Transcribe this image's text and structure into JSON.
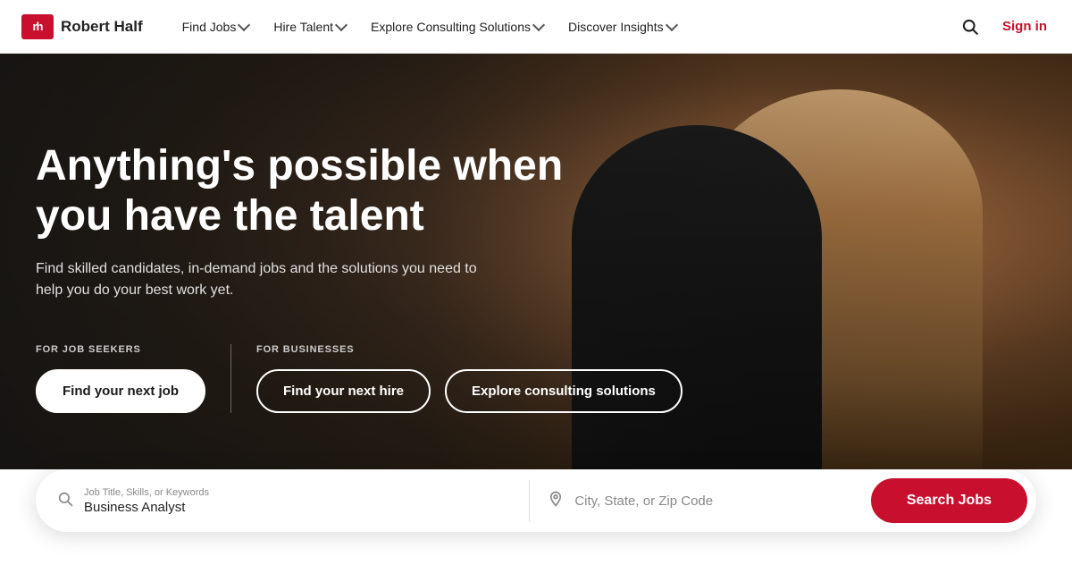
{
  "brand": {
    "logo_text": "rh",
    "name": "Robert Half"
  },
  "nav": {
    "items": [
      {
        "id": "find-jobs",
        "label": "Find Jobs",
        "has_dropdown": true
      },
      {
        "id": "hire-talent",
        "label": "Hire Talent",
        "has_dropdown": true
      },
      {
        "id": "explore-consulting",
        "label": "Explore Consulting Solutions",
        "has_dropdown": true
      },
      {
        "id": "discover-insights",
        "label": "Discover Insights",
        "has_dropdown": true
      }
    ],
    "sign_in_label": "Sign in"
  },
  "hero": {
    "headline": "Anything's possible when you have the talent",
    "subtext": "Find skilled candidates, in-demand jobs and the solutions you need to help you do your best work yet.",
    "for_job_seekers_label": "FOR JOB SEEKERS",
    "for_businesses_label": "FOR BUSINESSES",
    "btn_find_job": "Find your next job",
    "btn_find_hire": "Find your next hire",
    "btn_consulting": "Explore consulting solutions"
  },
  "search_bar": {
    "job_field_label": "Job Title, Skills, or Keywords",
    "job_field_value": "Business Analyst",
    "location_placeholder": "City, State, or Zip Code",
    "search_btn_label": "Search Jobs"
  },
  "colors": {
    "brand_red": "#c8102e",
    "white": "#ffffff",
    "dark": "#1a1a1a"
  }
}
